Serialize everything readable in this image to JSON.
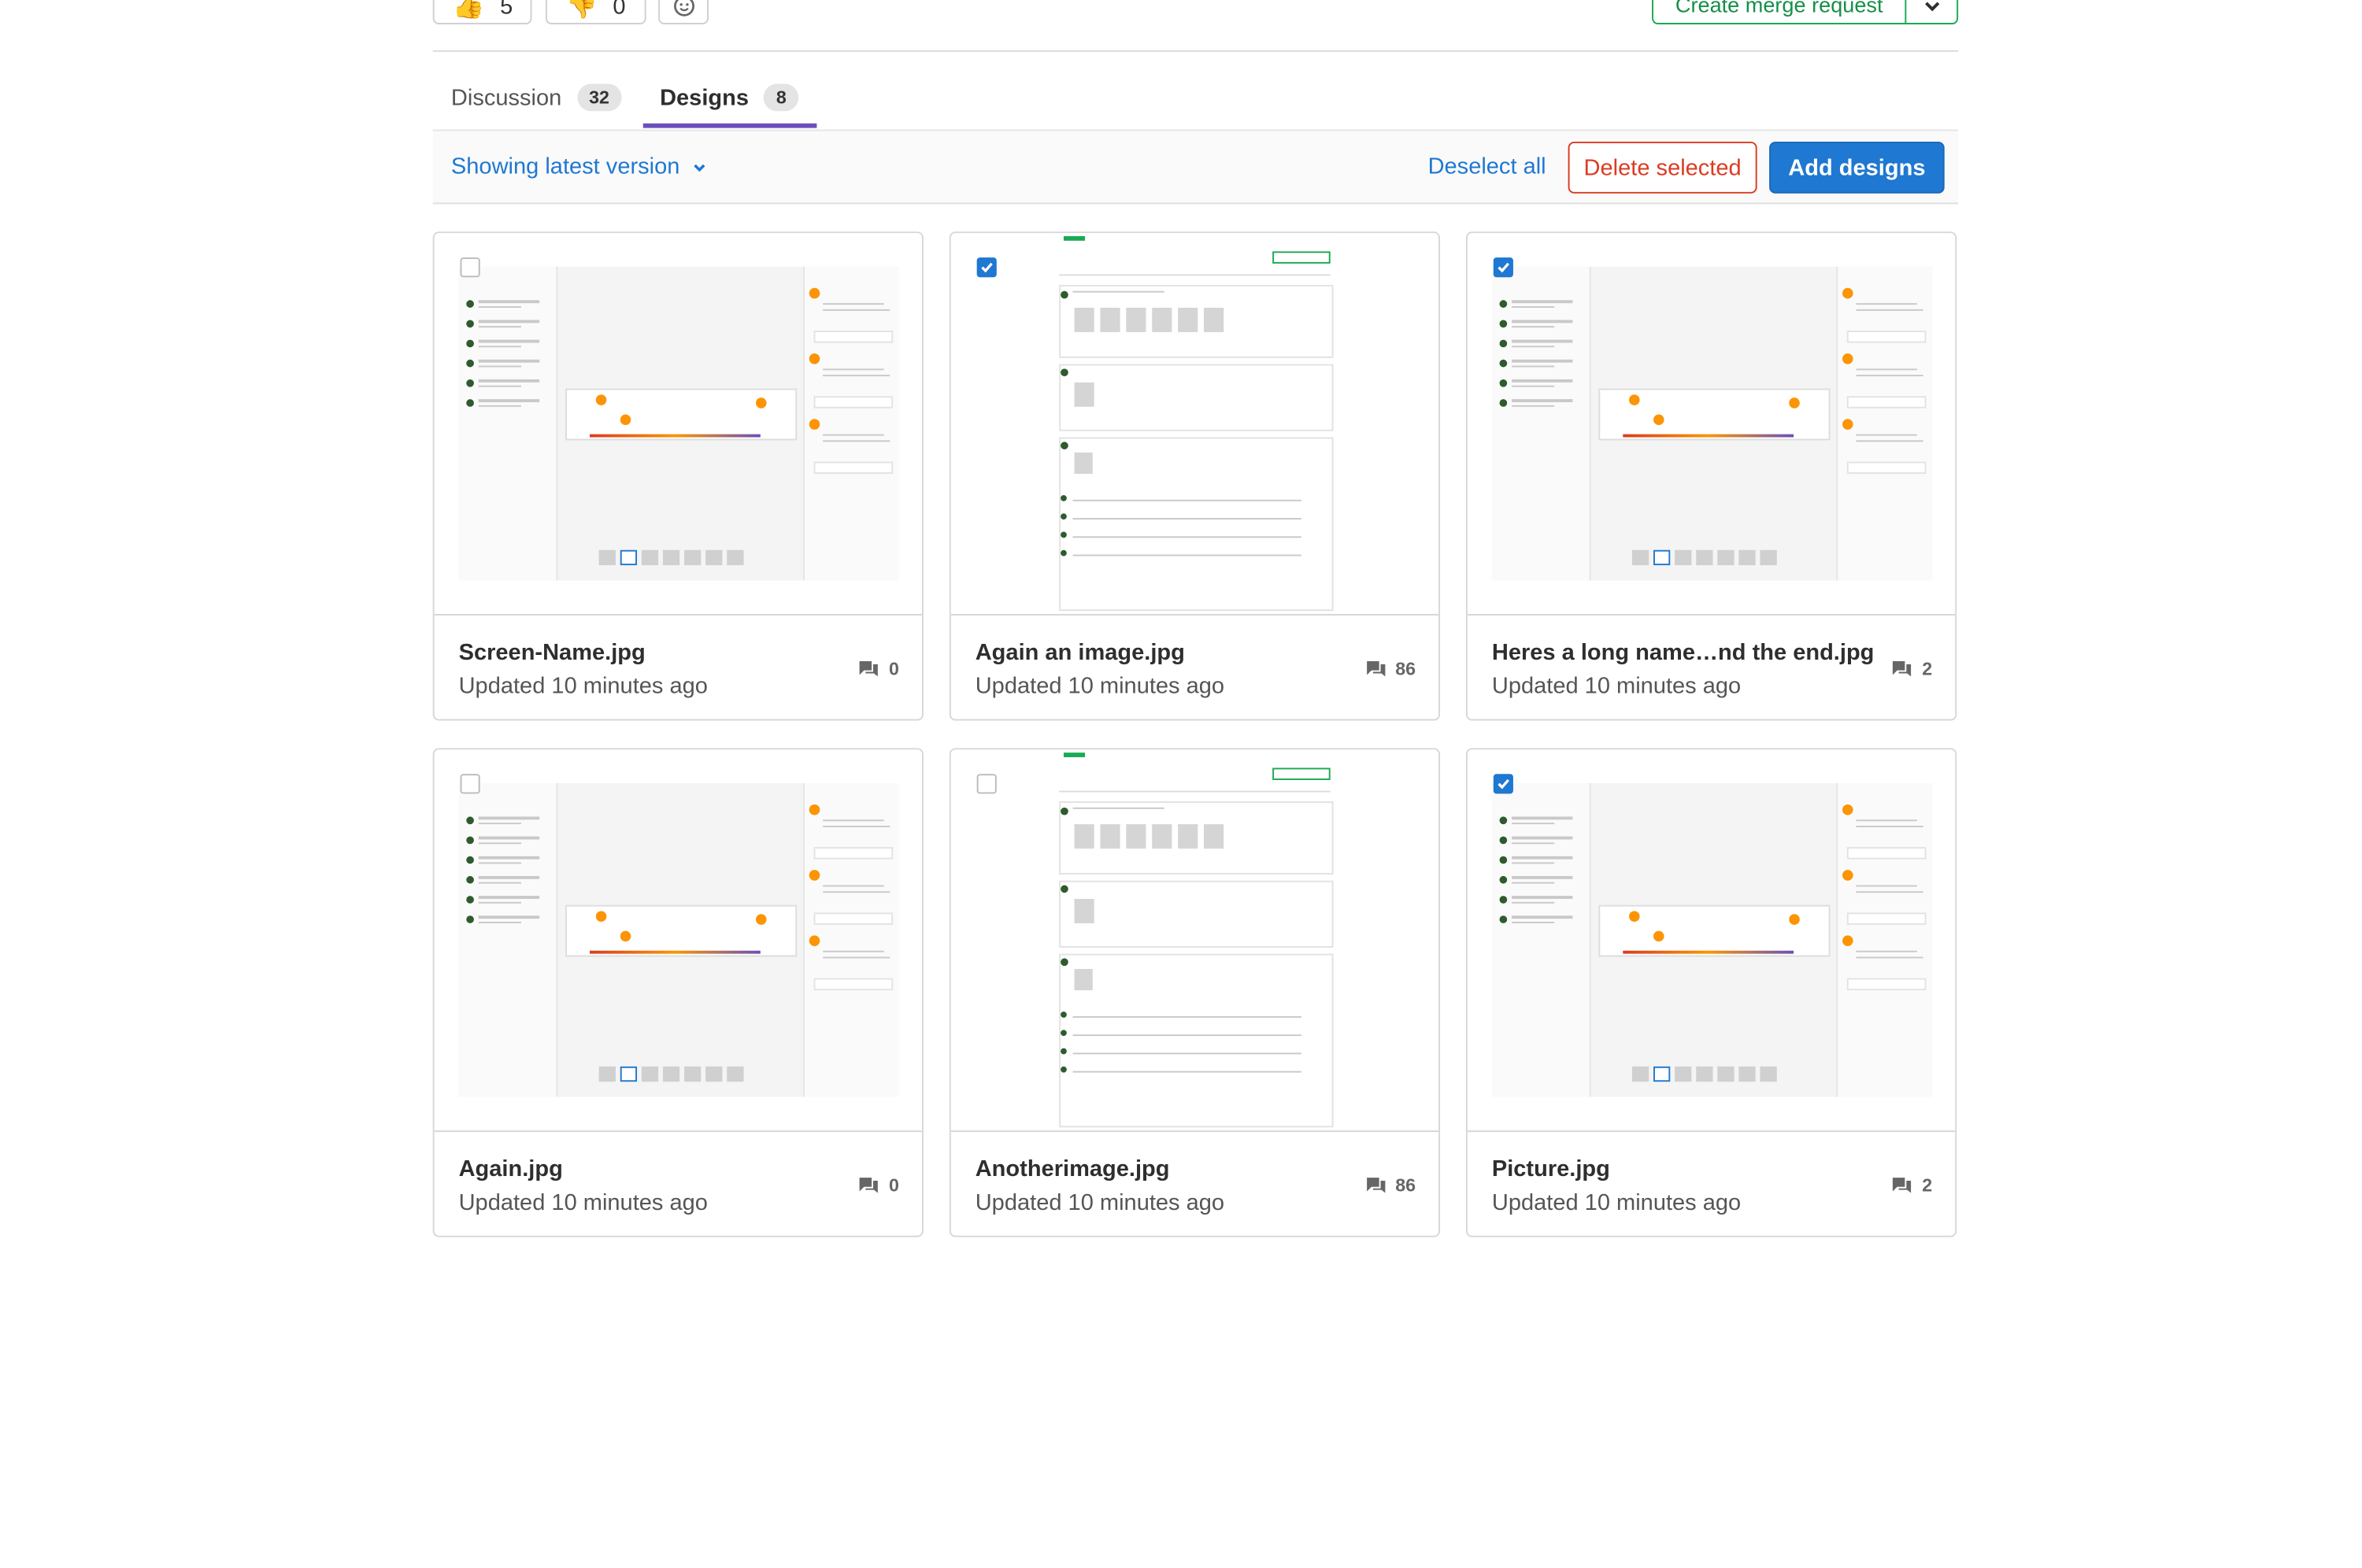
{
  "awards": {
    "thumbs_up": {
      "emoji": "👍",
      "count": "5"
    },
    "thumbs_down": {
      "emoji": "👎",
      "count": "0"
    }
  },
  "create_mr_label": "Create merge request",
  "tabs": [
    {
      "label": "Discussion",
      "count": "32"
    },
    {
      "label": "Designs",
      "count": "8"
    }
  ],
  "toolbar": {
    "version_label": "Showing latest version",
    "deselect_label": "Deselect all",
    "delete_label": "Delete selected",
    "add_label": "Add designs"
  },
  "designs": [
    {
      "name": "Screen-Name.jpg",
      "updated": "Updated 10 minutes ago",
      "comments": "0",
      "checked": false,
      "thumb": "a"
    },
    {
      "name": "Again an image.jpg",
      "updated": "Updated 10 minutes ago",
      "comments": "86",
      "checked": true,
      "thumb": "b"
    },
    {
      "name": "Heres a long name…nd the end.jpg",
      "updated": "Updated 10 minutes ago",
      "comments": "2",
      "checked": true,
      "thumb": "a"
    },
    {
      "name": "Again.jpg",
      "updated": "Updated 10 minutes ago",
      "comments": "0",
      "checked": false,
      "thumb": "a"
    },
    {
      "name": "Anotherimage.jpg",
      "updated": "Updated 10 minutes ago",
      "comments": "86",
      "checked": false,
      "thumb": "b"
    },
    {
      "name": "Picture.jpg",
      "updated": "Updated 10 minutes ago",
      "comments": "2",
      "checked": true,
      "thumb": "a"
    }
  ],
  "colors": {
    "accent": "#1f78d1",
    "danger": "#db3b21",
    "success": "#1aaa55",
    "tab_active": "#6b4fbb"
  }
}
